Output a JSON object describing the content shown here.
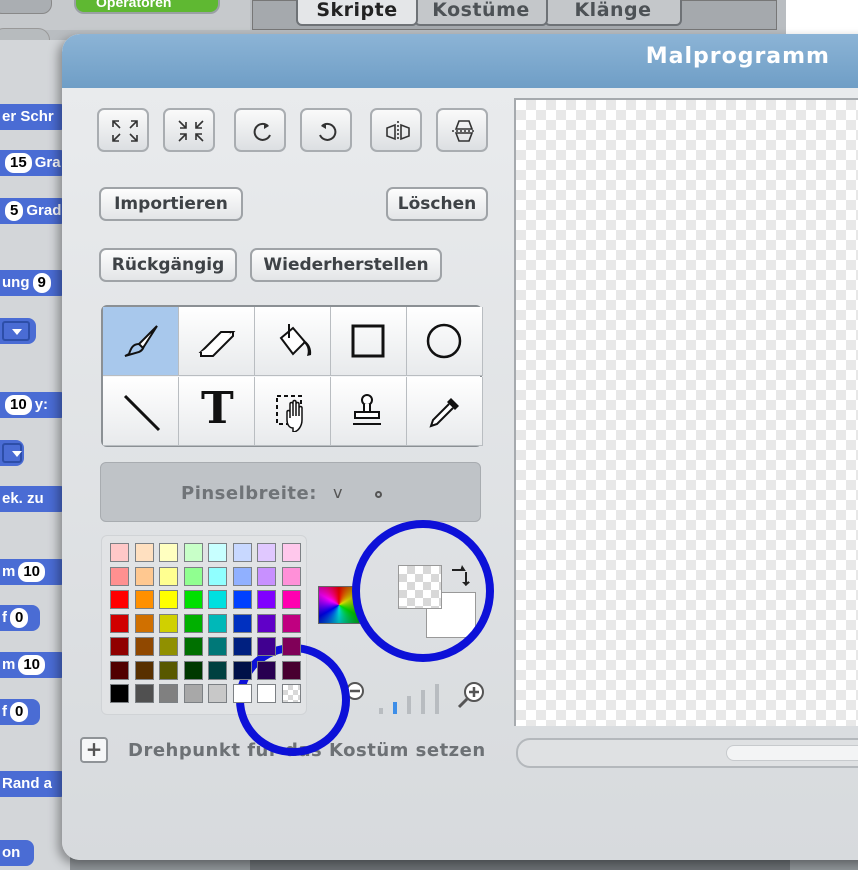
{
  "app": {
    "category_operators": "Operatoren",
    "tabs": [
      {
        "label": "Skripte",
        "active": true
      },
      {
        "label": "Kostüme",
        "active": false
      },
      {
        "label": "Klänge",
        "active": false
      }
    ]
  },
  "script_blocks": [
    {
      "text": "er Schr",
      "value": ""
    },
    {
      "text": "Gra",
      "value": "15"
    },
    {
      "text": "Grad",
      "value": "5"
    },
    {
      "text": "ung",
      "value": "9"
    },
    {
      "text": "y:",
      "value": "10"
    },
    {
      "text": "ek. zu",
      "value": ""
    },
    {
      "text": "m",
      "value": "10"
    },
    {
      "text": "f",
      "value": "0"
    },
    {
      "text": "m",
      "value": "10"
    },
    {
      "text": "f",
      "value": "0"
    },
    {
      "text": "Rand a",
      "value": ""
    },
    {
      "text": "on",
      "value": ""
    }
  ],
  "dialog": {
    "title": "Malprogramm",
    "transform_tools": [
      "grow-icon",
      "shrink-icon",
      "rotate-left-icon",
      "rotate-right-icon",
      "flip-horizontal-icon",
      "flip-vertical-icon"
    ],
    "buttons": {
      "import": "Importieren",
      "clear": "Löschen",
      "undo": "Rückgängig",
      "redo": "Wiederherstellen"
    },
    "tools": [
      {
        "name": "paintbrush",
        "selected": true
      },
      {
        "name": "eraser",
        "selected": false
      },
      {
        "name": "fill",
        "selected": false
      },
      {
        "name": "rectangle",
        "selected": false
      },
      {
        "name": "ellipse",
        "selected": false
      },
      {
        "name": "line",
        "selected": false
      },
      {
        "name": "text",
        "selected": false,
        "glyph": "T"
      },
      {
        "name": "select",
        "selected": false
      },
      {
        "name": "stamp",
        "selected": false
      },
      {
        "name": "eyedropper",
        "selected": false
      }
    ],
    "brush_size_label": "Pinselbreite:",
    "brush_size_chevron": "v",
    "palette": [
      [
        "#ffc8c8",
        "#ffe0c0",
        "#ffffc0",
        "#c8ffc8",
        "#c8ffff",
        "#c8d8ff",
        "#e0c8ff",
        "#ffc8ec"
      ],
      [
        "#ff9090",
        "#ffc890",
        "#ffff90",
        "#90ff90",
        "#90ffff",
        "#90b0ff",
        "#c890ff",
        "#ff90d8"
      ],
      [
        "#ff0000",
        "#ff9000",
        "#ffff00",
        "#00e000",
        "#00e0e0",
        "#0040ff",
        "#8000ff",
        "#ff00b0"
      ],
      [
        "#d00000",
        "#d07000",
        "#d0d000",
        "#00b000",
        "#00b8b8",
        "#0030c0",
        "#6000c8",
        "#c00080"
      ],
      [
        "#900000",
        "#904800",
        "#909000",
        "#007000",
        "#007878",
        "#002080",
        "#400090",
        "#800058"
      ],
      [
        "#500000",
        "#583000",
        "#585800",
        "#003800",
        "#004040",
        "#001048",
        "#280050",
        "#480030"
      ],
      [
        "#000000",
        "#505050",
        "#808080",
        "#a8a8a8",
        "#c8c8c8",
        "#ffffff",
        "#ffffff",
        "transparent"
      ]
    ],
    "set_rotation_center": "Drehpunkt für das Kostüm setzen",
    "zoom_level_index": 1,
    "zoom_levels": 5,
    "annotation_color": "#0d11d8"
  }
}
